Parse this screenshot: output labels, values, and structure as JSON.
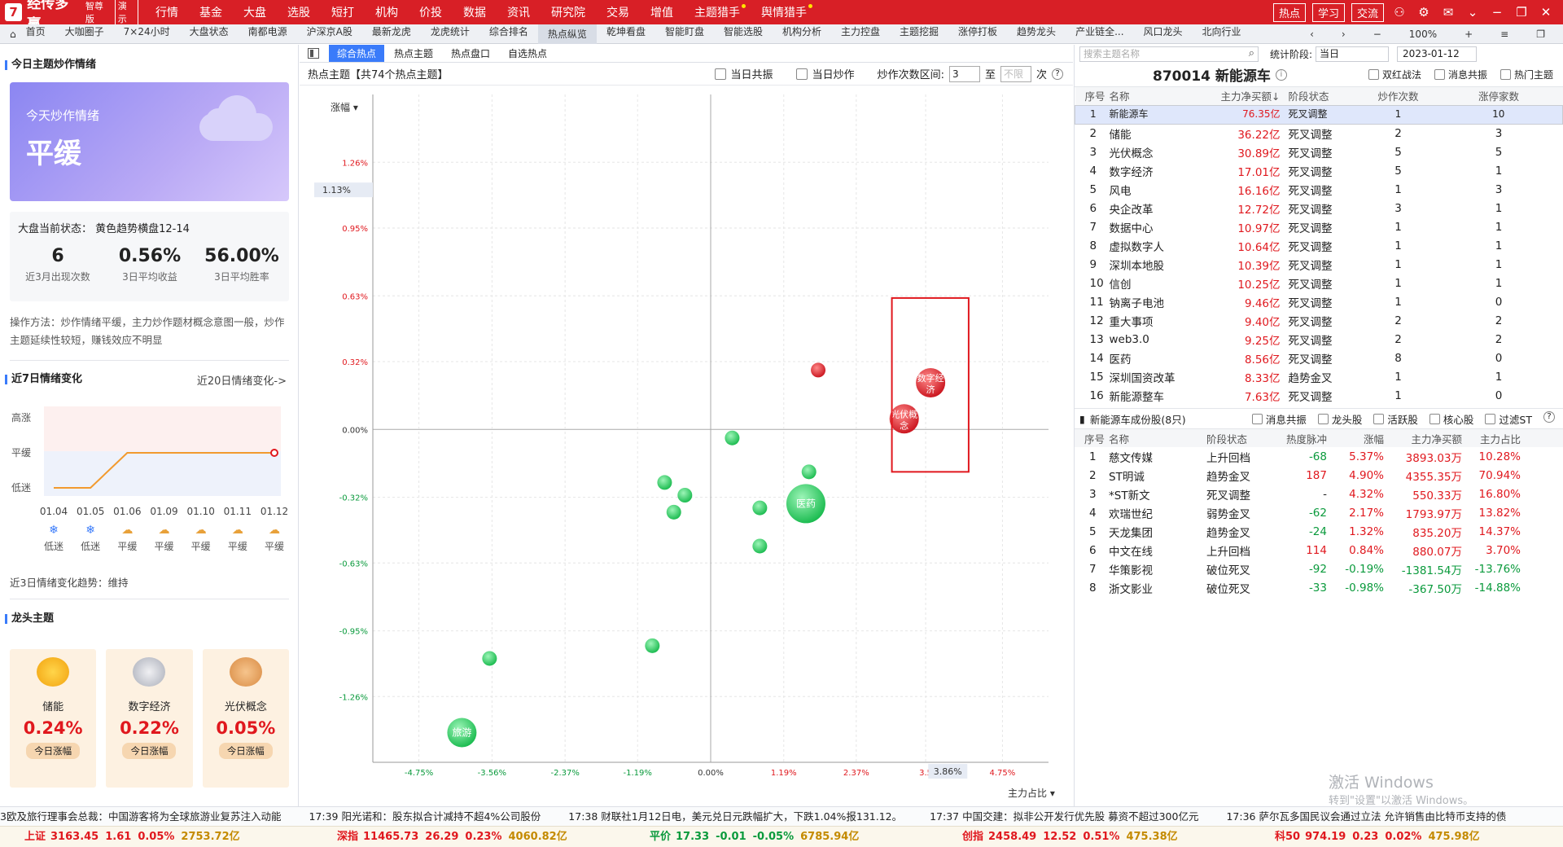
{
  "app": {
    "logo": "7",
    "name": "经传多赢",
    "edition": "智尊版",
    "demo": "演示",
    "menu": [
      "行情",
      "基金",
      "大盘",
      "选股",
      "短打",
      "机构",
      "价投",
      "数据",
      "资讯",
      "研究院",
      "交易",
      "增值",
      "主题猎手",
      "舆情猎手"
    ],
    "buttons": [
      "热点",
      "学习",
      "交流"
    ],
    "icons": [
      "user-icon",
      "settings-icon",
      "mail-icon",
      "minimize-icon",
      "restore-icon",
      "close-icon"
    ]
  },
  "nav": {
    "items": [
      "首页",
      "大咖圈子",
      "7×24小时",
      "大盘状态",
      "南都电源",
      "沪深京A股",
      "最新龙虎",
      "龙虎统计",
      "综合排名",
      "热点纵览",
      "乾坤看盘",
      "智能盯盘",
      "智能选股",
      "机构分析",
      "主力控盘",
      "主题挖掘",
      "涨停打板",
      "趋势龙头",
      "产业链全...",
      "风口龙头",
      "北向行业"
    ],
    "active": 9,
    "zoom": "100%"
  },
  "left": {
    "mood_title": "今日主题炒作情绪",
    "mood_sub": "今天炒作情绪",
    "mood_value": "平缓",
    "state_line": "大盘当前状态： 黄色趋势横盘12-14",
    "stats": [
      {
        "value": "6",
        "label": "近3月出现次数"
      },
      {
        "value": "0.56%",
        "label": "3日平均收益"
      },
      {
        "value": "56.00%",
        "label": "3日平均胜率"
      }
    ],
    "method": "操作方法：炒作情绪平缓，主力炒作题材概念意图一般，炒作主题延续性较短，赚钱效应不明显",
    "trend_title": "近7日情绪变化",
    "trend_more": "近20日情绪变化->",
    "levels": [
      "高涨",
      "平缓",
      "低迷"
    ],
    "days": [
      "01.04",
      "01.05",
      "01.06",
      "01.09",
      "01.10",
      "01.11",
      "01.12"
    ],
    "day_states": [
      "低迷",
      "低迷",
      "平缓",
      "平缓",
      "平缓",
      "平缓",
      "平缓"
    ],
    "day_values": [
      0,
      0,
      1,
      1,
      1,
      1,
      1
    ],
    "trend_note": "近3日情绪变化趋势：维持",
    "dragon_title": "龙头主题",
    "dragons": [
      {
        "name": "储能",
        "pct": "0.24%",
        "tag": "今日涨幅",
        "medal": "gold-medal-icon"
      },
      {
        "name": "数字经济",
        "pct": "0.22%",
        "tag": "今日涨幅",
        "medal": "silver-medal-icon"
      },
      {
        "name": "光伏概念",
        "pct": "0.05%",
        "tag": "今日涨幅",
        "medal": "bronze-medal-icon"
      }
    ]
  },
  "mid": {
    "tabs": [
      "综合热点",
      "热点主题",
      "热点盘口",
      "自选热点"
    ],
    "active_tab": 0,
    "title": "热点主题【共74个热点主题】",
    "opt1": "当日共振",
    "opt2": "当日炒作",
    "range_label": "炒作次数区间:",
    "range_from": "3",
    "range_to_label": "至",
    "range_to_ph": "不限",
    "range_unit": "次",
    "y_axis_label": "涨幅",
    "x_axis_label": "主力占比",
    "y_marker": "1.13%",
    "x_marker": "3.86%"
  },
  "chart_data": {
    "type": "scatter",
    "xlabel": "主力占比",
    "ylabel": "涨幅",
    "x_ticks": [
      "-4.75%",
      "-3.56%",
      "-2.37%",
      "-1.19%",
      "0.00%",
      "1.19%",
      "2.37%",
      "3.5",
      "4.75%"
    ],
    "y_ticks": [
      "1.26%",
      "0.95%",
      "0.63%",
      "0.32%",
      "0.00%",
      "-0.32%",
      "-0.63%",
      "-0.95%",
      "-1.26%"
    ],
    "xlim": [
      -5.5,
      5.5
    ],
    "ylim": [
      -1.57,
      1.58
    ],
    "points": [
      {
        "name": "数字经济",
        "x": 3.58,
        "y": 0.22,
        "r": 18,
        "color": "red"
      },
      {
        "name": "光伏概念",
        "x": 3.15,
        "y": 0.05,
        "r": 18,
        "color": "red"
      },
      {
        "name": "",
        "x": 1.75,
        "y": 0.28,
        "r": 9,
        "color": "red"
      },
      {
        "name": "医药",
        "x": 1.55,
        "y": -0.35,
        "r": 24,
        "color": "green"
      },
      {
        "name": "",
        "x": 0.35,
        "y": -0.04,
        "r": 9,
        "color": "green"
      },
      {
        "name": "",
        "x": 1.6,
        "y": -0.2,
        "r": 9,
        "color": "green"
      },
      {
        "name": "",
        "x": 0.8,
        "y": -0.37,
        "r": 9,
        "color": "green"
      },
      {
        "name": "",
        "x": 0.8,
        "y": -0.55,
        "r": 9,
        "color": "green"
      },
      {
        "name": "",
        "x": -0.75,
        "y": -0.25,
        "r": 9,
        "color": "green"
      },
      {
        "name": "",
        "x": -0.42,
        "y": -0.31,
        "r": 9,
        "color": "green"
      },
      {
        "name": "",
        "x": -0.6,
        "y": -0.39,
        "r": 9,
        "color": "green"
      },
      {
        "name": "",
        "x": -0.95,
        "y": -1.02,
        "r": 9,
        "color": "green"
      },
      {
        "name": "",
        "x": -3.6,
        "y": -1.08,
        "r": 9,
        "color": "green"
      },
      {
        "name": "旅游",
        "x": -4.05,
        "y": -1.43,
        "r": 18,
        "color": "green"
      }
    ]
  },
  "right": {
    "search_ph": "搜索主题名称",
    "period_label": "统计阶段:",
    "period": "当日",
    "date": "2023-01-12",
    "stock": "870014 新能源车",
    "opts": [
      "双红战法",
      "消息共振",
      "热门主题"
    ],
    "headers": [
      "序号",
      "名称",
      "主力净买额↓",
      "阶段状态",
      "炒作次数",
      "涨停家数"
    ],
    "rows": [
      [
        "1",
        "新能源车",
        "76.35亿",
        "死叉调整",
        "1",
        "10"
      ],
      [
        "2",
        "储能",
        "36.22亿",
        "死叉调整",
        "2",
        "3"
      ],
      [
        "3",
        "光伏概念",
        "30.89亿",
        "死叉调整",
        "5",
        "5"
      ],
      [
        "4",
        "数字经济",
        "17.01亿",
        "死叉调整",
        "5",
        "1"
      ],
      [
        "5",
        "风电",
        "16.16亿",
        "死叉调整",
        "1",
        "3"
      ],
      [
        "6",
        "央企改革",
        "12.72亿",
        "死叉调整",
        "3",
        "1"
      ],
      [
        "7",
        "数据中心",
        "10.97亿",
        "死叉调整",
        "1",
        "1"
      ],
      [
        "8",
        "虚拟数字人",
        "10.64亿",
        "死叉调整",
        "1",
        "1"
      ],
      [
        "9",
        "深圳本地股",
        "10.39亿",
        "死叉调整",
        "1",
        "1"
      ],
      [
        "10",
        "信创",
        "10.25亿",
        "死叉调整",
        "1",
        "1"
      ],
      [
        "11",
        "钠离子电池",
        "9.46亿",
        "死叉调整",
        "1",
        "0"
      ],
      [
        "12",
        "重大事项",
        "9.40亿",
        "死叉调整",
        "2",
        "2"
      ],
      [
        "13",
        "web3.0",
        "9.25亿",
        "死叉调整",
        "2",
        "2"
      ],
      [
        "14",
        "医药",
        "8.56亿",
        "死叉调整",
        "8",
        "0"
      ],
      [
        "15",
        "深圳国资改革",
        "8.33亿",
        "趋势金叉",
        "1",
        "1"
      ],
      [
        "16",
        "新能源整车",
        "7.63亿",
        "死叉调整",
        "1",
        "0"
      ]
    ],
    "comp_title": "新能源车成份股(8只)",
    "comp_opts": [
      "消息共振",
      "龙头股",
      "活跃股",
      "核心股",
      "过滤ST"
    ],
    "comp_headers": [
      "序号",
      "名称",
      "阶段状态",
      "热度脉冲",
      "涨幅",
      "主力净买额",
      "主力占比"
    ],
    "comp_rows": [
      [
        "1",
        "慈文传媒",
        "上升回档",
        "-68",
        "5.37%",
        "3893.03万",
        "10.28%"
      ],
      [
        "2",
        "ST明诚",
        "趋势金叉",
        "187",
        "4.90%",
        "4355.35万",
        "70.94%"
      ],
      [
        "3",
        "*ST新文",
        "死叉调整",
        "-",
        "4.32%",
        "550.33万",
        "16.80%"
      ],
      [
        "4",
        "欢瑞世纪",
        "弱势金叉",
        "-62",
        "2.17%",
        "1793.97万",
        "13.82%"
      ],
      [
        "5",
        "天龙集团",
        "趋势金叉",
        "-24",
        "1.32%",
        "835.20万",
        "14.37%"
      ],
      [
        "6",
        "中文在线",
        "上升回档",
        "114",
        "0.84%",
        "880.07万",
        "3.70%"
      ],
      [
        "7",
        "华策影视",
        "破位死叉",
        "-92",
        "-0.19%",
        "-1381.54万",
        "-13.76%"
      ],
      [
        "8",
        "浙文影业",
        "破位死叉",
        "-33",
        "-0.98%",
        "-367.50万",
        "-14.88%"
      ]
    ],
    "watermark": "激活 Windows",
    "watermark2": "转到\"设置\"以激活 Windows。"
  },
  "news": [
    "3欧及旅行理事会总裁：中国游客将为全球旅游业复苏注入动能",
    "17:39 阳光诺和：股东拟合计减持不超4%公司股份",
    "17:38 财联社1月12日电，美元兑日元跌幅扩大，下跌1.04%报131.12。",
    "17:37 中国交建：拟非公开发行优先股 募资不超过300亿元",
    "17:36 萨尔瓦多国民议会通过立法 允许销售由比特币支持的债"
  ],
  "indices": [
    {
      "name": "上证",
      "val": "3163.45",
      "chg": "1.61",
      "pct": "0.05%",
      "amt": "2753.72亿",
      "up": true
    },
    {
      "name": "深指",
      "val": "11465.73",
      "chg": "26.29",
      "pct": "0.23%",
      "amt": "4060.82亿",
      "up": true
    },
    {
      "name": "平价",
      "val": "17.33",
      "chg": "-0.01",
      "pct": "-0.05%",
      "amt": "6785.94亿",
      "up": false
    },
    {
      "name": "创指",
      "val": "2458.49",
      "chg": "12.52",
      "pct": "0.51%",
      "amt": "475.38亿",
      "up": true
    },
    {
      "name": "科50",
      "val": "974.19",
      "chg": "0.23",
      "pct": "0.02%",
      "amt": "475.98亿",
      "up": true
    }
  ]
}
